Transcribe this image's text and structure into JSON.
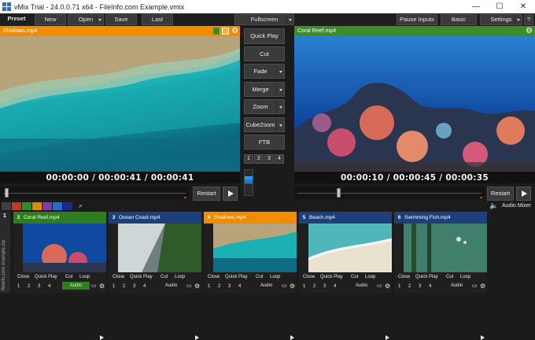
{
  "window": {
    "title": "vMix Trial - 24.0.0.71 x64 - FileInfo.com Example.vmix",
    "minimize": "—",
    "maximize": "☐",
    "close": "✕"
  },
  "toolbar": {
    "preset": "Preset",
    "new": "New",
    "open": "Open",
    "save": "Save",
    "last": "Last",
    "fullscreen": "Fullscreen",
    "pause_inputs": "Pause Inputs",
    "basic": "Basic",
    "settings": "Settings",
    "help": "?"
  },
  "preview": {
    "filename": "Shallows.mp4",
    "timecode": "00:00:00  /  00:00:41  /  00:00:41",
    "restart": "Restart"
  },
  "output": {
    "filename": "Coral Reef.mp4",
    "timecode": "00:00:10  /  00:00:45  /  00:00:35",
    "restart": "Restart"
  },
  "transitions": {
    "quick_play": "Quick Play",
    "cut": "Cut",
    "fade": "Fade",
    "merge": "Merge",
    "zoom": "Zoom",
    "cubezoom": "CubeZoom",
    "ftb": "FTB",
    "numbers": [
      "1",
      "2",
      "3",
      "4"
    ]
  },
  "audio_mixer": "Audio Mixer",
  "side_label": "fileinfo.com example.zip",
  "inputs": [
    {
      "num": "1",
      "name": "",
      "state": "none"
    },
    {
      "num": "2",
      "name": "Coral Reef.mp4",
      "state": "active"
    },
    {
      "num": "3",
      "name": "Ocean Coast.mp4",
      "state": "normal"
    },
    {
      "num": "4",
      "name": "Shallows.mp4",
      "state": "preview"
    },
    {
      "num": "5",
      "name": "Beach.mp4",
      "state": "normal"
    },
    {
      "num": "6",
      "name": "Swimming Fish.mp4",
      "state": "normal"
    }
  ],
  "tile_controls": {
    "close": "Close",
    "quick_play": "Quick Play",
    "cut": "Cut",
    "loop": "Loop",
    "audio": "Audio",
    "nums": [
      "1",
      "2",
      "3",
      "4"
    ]
  },
  "colors": {
    "preview_orange": "#f08c00",
    "output_green": "#3c8c2a",
    "input_blue": "#1f3f7a",
    "active_green": "#2e7d1e"
  },
  "color_swatches": [
    "#404040",
    "#c0392b",
    "#2e8b2e",
    "#e08a00",
    "#7b3fa0",
    "#1e6fc9",
    "#1a2a8a"
  ]
}
